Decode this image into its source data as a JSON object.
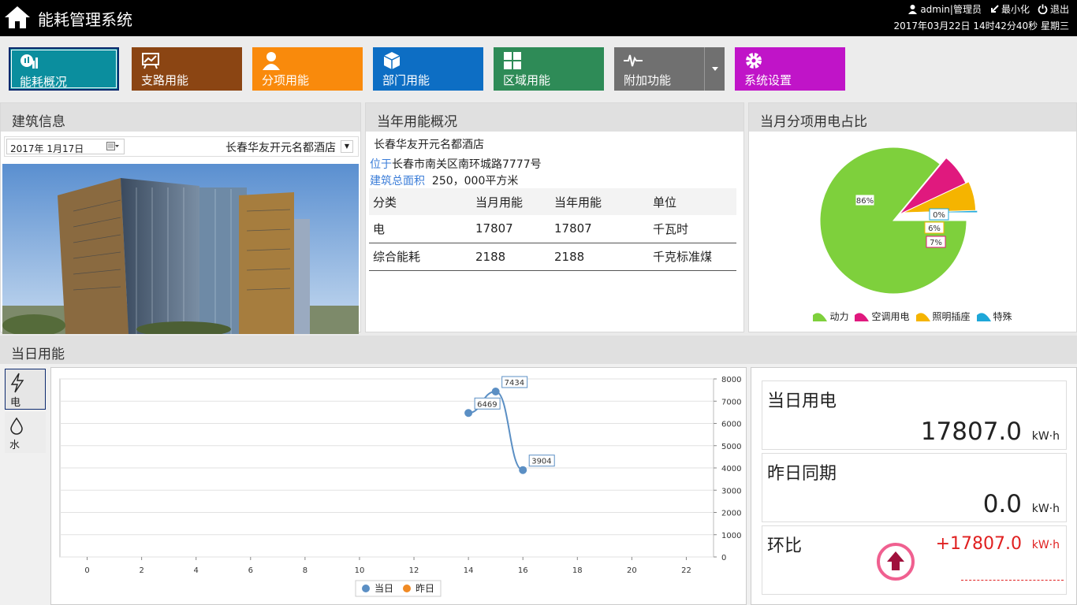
{
  "header": {
    "title": "能耗管理系统",
    "user": "admin|管理员",
    "minimize": "最小化",
    "logout": "退出",
    "datetime": "2017年03月22日 14时42分40秒 星期三"
  },
  "nav": [
    {
      "label": "能耗概况",
      "color": "#0b8e9e",
      "icon": "dashboard-icon"
    },
    {
      "label": "支路用能",
      "color": "#8b4513",
      "icon": "trend-chart-icon"
    },
    {
      "label": "分项用能",
      "color": "#f98a0c",
      "icon": "person-icon"
    },
    {
      "label": "部门用能",
      "color": "#0d6ec4",
      "icon": "cube-icon"
    },
    {
      "label": "区域用能",
      "color": "#2e8b57",
      "icon": "grid-icon"
    },
    {
      "label": "附加功能",
      "color": "#707070",
      "icon": "pulse-icon"
    },
    {
      "label": "系统设置",
      "color": "#c014c8",
      "icon": "gear-icon"
    }
  ],
  "building": {
    "heading": "建筑信息",
    "date": "2017年  1月17日",
    "selected": "长春华友开元名都酒店"
  },
  "annual": {
    "heading": "当年用能概况",
    "name": "长春华友开元名都酒店",
    "location_label": "位于",
    "location": "长春市南关区南环城路7777号",
    "area_label": "建筑总面积",
    "area": "250，000平方米",
    "columns": [
      "分类",
      "当月用能",
      "当年用能",
      "单位"
    ],
    "rows": [
      [
        "电",
        "17807",
        "17807",
        "千瓦时"
      ],
      [
        "综合能耗",
        "2188",
        "2188",
        "千克标准煤"
      ]
    ]
  },
  "pie": {
    "heading": "当月分项用电占比",
    "chart_data": {
      "type": "pie",
      "slices": [
        {
          "name": "动力",
          "value": 86,
          "label": "86%",
          "color": "#7ed03c"
        },
        {
          "name": "空调用电",
          "value": 7,
          "label": "7%",
          "color": "#e0197e"
        },
        {
          "name": "照明插座",
          "value": 6.5,
          "label": "6%",
          "color": "#f5b400"
        },
        {
          "name": "特殊",
          "value": 0.5,
          "label": "0%",
          "color": "#1ea7d8"
        }
      ]
    }
  },
  "daily": {
    "heading": "当日用能",
    "tabs": [
      {
        "label": "电",
        "icon": "lightning-icon"
      },
      {
        "label": "水",
        "icon": "water-drop-icon"
      }
    ],
    "chart_data": {
      "type": "line",
      "x_ticks": [
        0,
        2,
        4,
        6,
        8,
        10,
        12,
        14,
        16,
        18,
        20,
        22
      ],
      "y_ticks": [
        0,
        1000,
        2000,
        3000,
        4000,
        5000,
        6000,
        7000,
        8000
      ],
      "xlim": [
        -1,
        23
      ],
      "ylim": [
        0,
        8000
      ],
      "series": [
        {
          "name": "当日",
          "color": "#5b8fc4",
          "points": [
            [
              14,
              6469
            ],
            [
              15,
              7434
            ],
            [
              16,
              3904
            ]
          ]
        },
        {
          "name": "昨日",
          "color": "#f08a24",
          "points": []
        }
      ]
    },
    "stats": [
      {
        "title": "当日用电",
        "value": "17807.0",
        "unit": "kW·h"
      },
      {
        "title": "昨日同期",
        "value": "0.0",
        "unit": "kW·h"
      },
      {
        "title": "环比",
        "value": "+17807.0",
        "unit": "kW·h"
      }
    ]
  }
}
